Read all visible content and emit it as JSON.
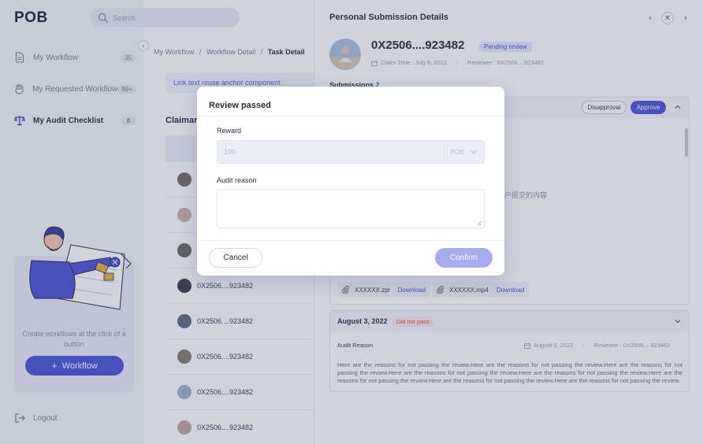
{
  "app": {
    "logo": "POB",
    "search_placeholder": "Search"
  },
  "sidebar": {
    "items": [
      {
        "label": "My Workflow",
        "count": "35",
        "icon": "document-icon"
      },
      {
        "label": "My Requested Workflow",
        "count": "99+",
        "icon": "hand-icon"
      },
      {
        "label": "My Audit Checklist",
        "count": "8",
        "icon": "scales-icon"
      }
    ],
    "promo_text": "Create workflows at the click of a button",
    "promo_button": "Workflow",
    "logout": "Logout"
  },
  "breadcrumb": {
    "items": [
      "My Workflow",
      "Workflow Detail"
    ],
    "separator": "/",
    "current": "Task Detail"
  },
  "main": {
    "link_text": "Link text reuse anchor component",
    "claimant_title": "Claimar",
    "claimants": [
      {
        "address": "",
        "avatar_color": "#7a6e69"
      },
      {
        "address": "",
        "avatar_color": "#c9b7a8"
      },
      {
        "address": "",
        "avatar_color": "#6f6a66"
      },
      {
        "address": "0X2506....923482",
        "avatar_color": "#3c3f46"
      },
      {
        "address": "0X2506....923482",
        "avatar_color": "#5b6f80"
      },
      {
        "address": "0X2506....923482",
        "avatar_color": "#8a7d70"
      },
      {
        "address": "0X2506....923482",
        "avatar_color": "#9bb3c9"
      },
      {
        "address": "0X2506....923482",
        "avatar_color": "#c4a6a0"
      }
    ]
  },
  "drawer": {
    "title": "Personal Submission Details",
    "address": "0X2506....923482",
    "status": "Pending review",
    "claim_time": "Claim Time : July 6, 2022",
    "reviewer": "Reviewer : 0X2506....923482",
    "submissions_label": "Submissions",
    "submissions_count": "2",
    "disapproval": "Disapproval",
    "approve": "Approve",
    "cn_text": "户提交的内容",
    "attachments": [
      {
        "name": "XXXXXX.zpi",
        "action": "Download"
      },
      {
        "name": "XXXXXX.mp4",
        "action": "Download"
      }
    ],
    "card2": {
      "date": "August 3, 2022",
      "status": "Did not pass",
      "audit_label": "Audit Reason",
      "date_meta": "August 3, 2022",
      "reviewer": "Reviewer : 0X2506....923482",
      "reason": "Here are the reasons for not passing the review.Here are the reasons for not passing the review.Here are the reasons for not passing the review.Here are the reasons for not passing the review.Here are the reasons for not passing the review.Here are the reasons for not passing the review.Here are the reasons for not passing the review.Here are the reasons for not passing the review."
    }
  },
  "modal": {
    "title": "Review passed",
    "reward_label": "Reward",
    "reward_value": "100",
    "reward_unit": "POB",
    "reason_label": "Audit reason",
    "reason_value": "",
    "cancel": "Cancel",
    "confirm": "Confirm"
  },
  "colors": {
    "accent": "#4b55d6",
    "confirm_disabled": "#a7acf0",
    "danger": "#e04848"
  }
}
